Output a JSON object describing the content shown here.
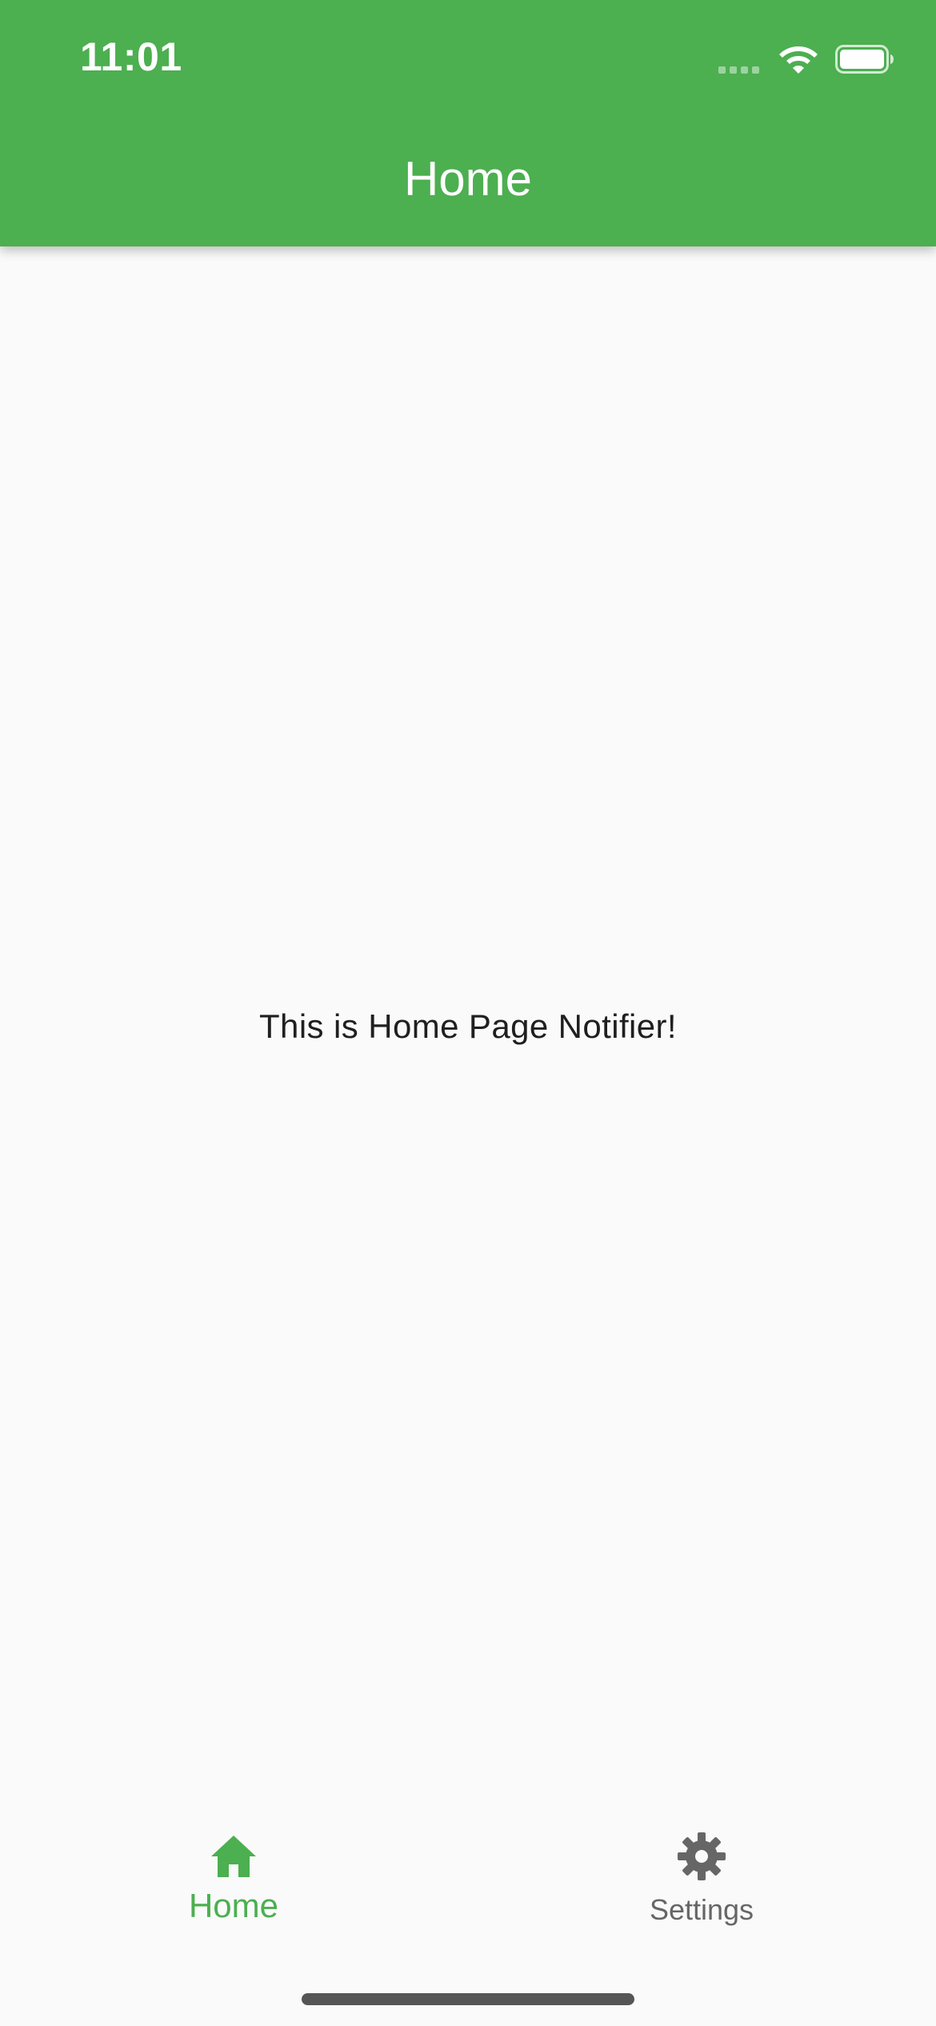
{
  "status_bar": {
    "time": "11:01"
  },
  "app_bar": {
    "title": "Home",
    "color": "#4caf50"
  },
  "body": {
    "message": "This is Home Page Notifier!"
  },
  "bottom_nav": {
    "items": [
      {
        "label": "Home",
        "icon": "home-icon",
        "selected": true,
        "color": "#4caf50"
      },
      {
        "label": "Settings",
        "icon": "gear-icon",
        "selected": false,
        "color": "#666666"
      }
    ]
  }
}
